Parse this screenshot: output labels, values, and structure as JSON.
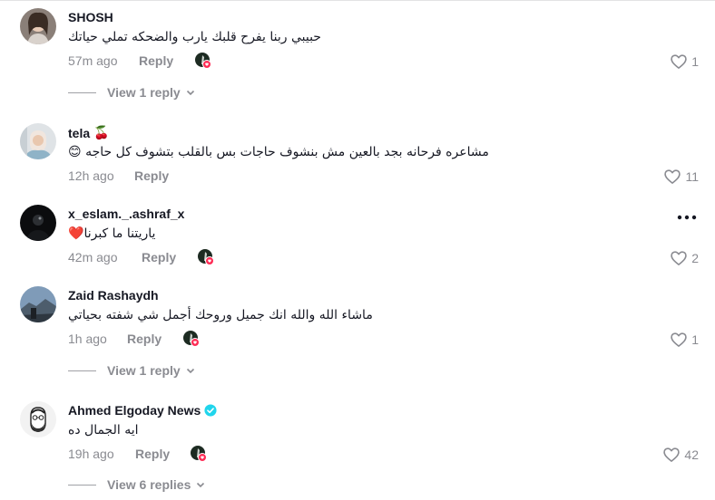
{
  "colors": {
    "text_primary": "#161823",
    "text_secondary": "#8a8b91",
    "verified_blue": "#20d5ec",
    "creator_badge": "#fe2c55"
  },
  "comments": [
    {
      "username": "SHOSH",
      "text": "حبيبي ربنا يفرح قلبك يارب والضحكه تملي حياتك",
      "time": "57m ago",
      "reply_label": "Reply",
      "likes": "1",
      "view_replies": "View 1 reply",
      "creator_liked": true
    },
    {
      "username": "tela",
      "username_emoji": "🍒",
      "text": "مشاعره فرحانه بجد بالعين مش بنشوف حاجات بس بالقلب بتشوف كل حاجه",
      "text_emoji": "😊",
      "time": "12h ago",
      "reply_label": "Reply",
      "likes": "11"
    },
    {
      "username": "x_eslam._.ashraf_x",
      "text": "ياريتنا ما كبرنا",
      "text_emoji": "❤️",
      "time": "42m ago",
      "reply_label": "Reply",
      "likes": "2",
      "creator_liked": true,
      "more_icon": "more-horizontal-icon"
    },
    {
      "username": "Zaid Rashaydh",
      "text": "ماشاء الله والله انك جميل وروحك أجمل شي شفته بحياتي",
      "time": "1h ago",
      "reply_label": "Reply",
      "likes": "1",
      "view_replies": "View 1 reply",
      "creator_liked": true
    },
    {
      "username": "Ahmed Elgoday News",
      "verified": true,
      "text": "ايه الجمال ده",
      "time": "19h ago",
      "reply_label": "Reply",
      "likes": "42",
      "view_replies": "View 6 replies",
      "creator_liked": true
    }
  ],
  "icons": {
    "like": "heart-outline-icon",
    "chevron": "chevron-down-icon",
    "verified": "verified-badge-icon"
  }
}
